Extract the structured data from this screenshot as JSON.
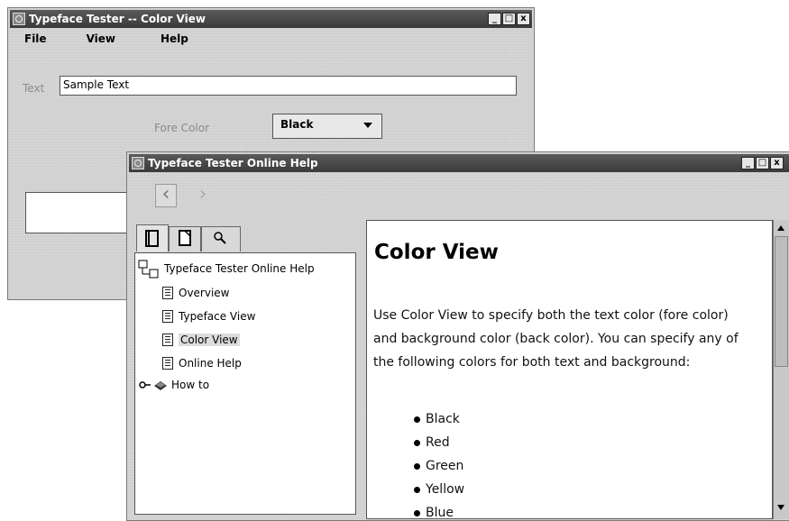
{
  "back_window": {
    "title": "Typeface Tester -- Color View",
    "menu": [
      "File",
      "View",
      "Help"
    ],
    "text_label": "Text",
    "text_value": "Sample Text",
    "fore_color_label": "Fore Color",
    "fore_color_value": "Black"
  },
  "help_window": {
    "title": "Typeface Tester Online Help",
    "toolbar": {
      "back_icon": "left-chevron-icon",
      "forward_icon": "right-chevron-icon"
    },
    "tabs": [
      "toc-tab",
      "index-tab",
      "search-tab"
    ],
    "tree": {
      "root": "Typeface Tester Online Help",
      "items": [
        "Overview",
        "Typeface View",
        "Color View",
        "Online Help"
      ],
      "selected": "Color View",
      "folder": "How to"
    },
    "content": {
      "heading": "Color View",
      "paragraph": "Use Color View to specify both the text color (fore color) and background color (back color). You can specify any of the following colors for both text and background:",
      "bullets": [
        "Black",
        "Red",
        "Green",
        "Yellow",
        "Blue"
      ]
    }
  },
  "window_buttons": {
    "minimize": "_",
    "maximize": "□",
    "close": "x"
  }
}
